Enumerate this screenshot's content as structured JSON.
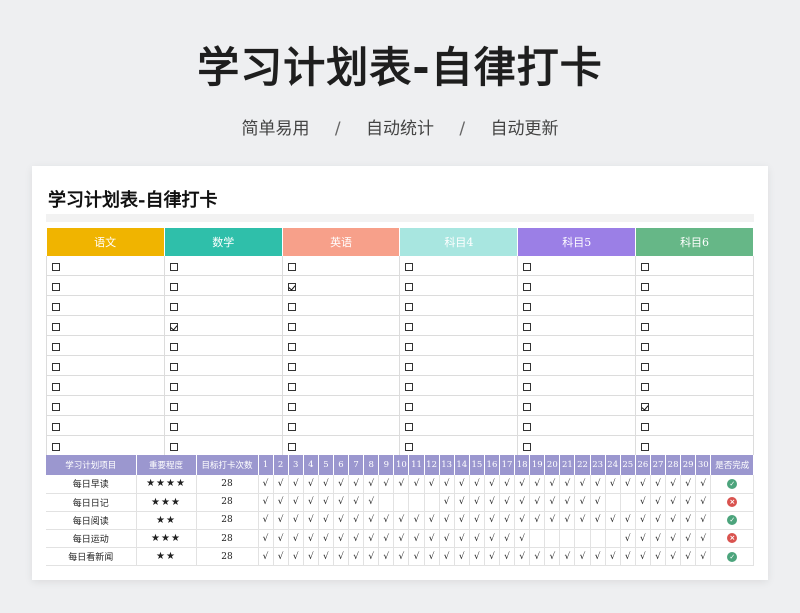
{
  "hero": {
    "title": "学习计划表-自律打卡",
    "features": [
      "简单易用",
      "自动统计",
      "自动更新"
    ],
    "separator": "/"
  },
  "card": {
    "title": "学习计划表-自律打卡",
    "subjects": [
      {
        "label": "语文",
        "color": "#f0b400"
      },
      {
        "label": "数学",
        "color": "#2fbfaa"
      },
      {
        "label": "英语",
        "color": "#f7a08a"
      },
      {
        "label": "科目4",
        "color": "#a8e6e0"
      },
      {
        "label": "科目5",
        "color": "#9b7fe6"
      },
      {
        "label": "科目6",
        "color": "#66b787"
      }
    ],
    "checkbox_grid": [
      [
        false,
        false,
        false,
        false,
        false,
        false
      ],
      [
        false,
        false,
        true,
        false,
        false,
        false
      ],
      [
        false,
        false,
        false,
        false,
        false,
        false
      ],
      [
        false,
        true,
        false,
        false,
        false,
        false
      ],
      [
        false,
        false,
        false,
        false,
        false,
        false
      ],
      [
        false,
        false,
        false,
        false,
        false,
        false
      ],
      [
        false,
        false,
        false,
        false,
        false,
        false
      ],
      [
        false,
        false,
        false,
        false,
        false,
        true
      ],
      [
        false,
        false,
        false,
        false,
        false,
        false
      ],
      [
        false,
        false,
        false,
        false,
        false,
        false
      ]
    ]
  },
  "habits": {
    "headers": {
      "item": "学习计划项目",
      "importance": "重要程度",
      "target": "目标打卡次数",
      "days": [
        "1",
        "2",
        "3",
        "4",
        "5",
        "6",
        "7",
        "8",
        "9",
        "10",
        "11",
        "12",
        "13",
        "14",
        "15",
        "16",
        "17",
        "18",
        "19",
        "20",
        "21",
        "22",
        "23",
        "24",
        "25",
        "26",
        "27",
        "28",
        "29",
        "30"
      ],
      "done": "是否完成"
    },
    "check_mark": "√",
    "rows": [
      {
        "name": "每日早读",
        "stars": "★★★★",
        "target": "28",
        "done": true,
        "days": [
          1,
          1,
          1,
          1,
          1,
          1,
          1,
          1,
          1,
          1,
          1,
          1,
          1,
          1,
          1,
          1,
          1,
          1,
          1,
          1,
          1,
          1,
          1,
          1,
          1,
          1,
          1,
          1,
          1,
          1
        ]
      },
      {
        "name": "每日日记",
        "stars": "★★★",
        "target": "28",
        "done": false,
        "days": [
          1,
          1,
          1,
          1,
          1,
          1,
          1,
          1,
          0,
          0,
          0,
          0,
          1,
          1,
          1,
          1,
          1,
          1,
          1,
          1,
          1,
          1,
          1,
          0,
          0,
          1,
          1,
          1,
          1,
          1
        ]
      },
      {
        "name": "每日阅读",
        "stars": "★★",
        "target": "28",
        "done": true,
        "days": [
          1,
          1,
          1,
          1,
          1,
          1,
          1,
          1,
          1,
          1,
          1,
          1,
          1,
          1,
          1,
          1,
          1,
          1,
          1,
          1,
          1,
          1,
          1,
          1,
          1,
          1,
          1,
          1,
          1,
          1
        ]
      },
      {
        "name": "每日运动",
        "stars": "★★★",
        "target": "28",
        "done": false,
        "days": [
          1,
          1,
          1,
          1,
          1,
          1,
          1,
          1,
          1,
          1,
          1,
          1,
          1,
          1,
          1,
          1,
          1,
          1,
          0,
          0,
          0,
          0,
          0,
          0,
          1,
          1,
          1,
          1,
          1,
          1
        ]
      },
      {
        "name": "每日看新闻",
        "stars": "★★",
        "target": "28",
        "done": true,
        "days": [
          1,
          1,
          1,
          1,
          1,
          1,
          1,
          1,
          1,
          1,
          1,
          1,
          1,
          1,
          1,
          1,
          1,
          1,
          1,
          1,
          1,
          1,
          1,
          1,
          1,
          1,
          1,
          1,
          1,
          1
        ]
      }
    ],
    "status_colors": {
      "done": "#4ca47c",
      "not_done": "#d9534f"
    },
    "status_glyphs": {
      "done": "✓",
      "not_done": "×"
    }
  }
}
